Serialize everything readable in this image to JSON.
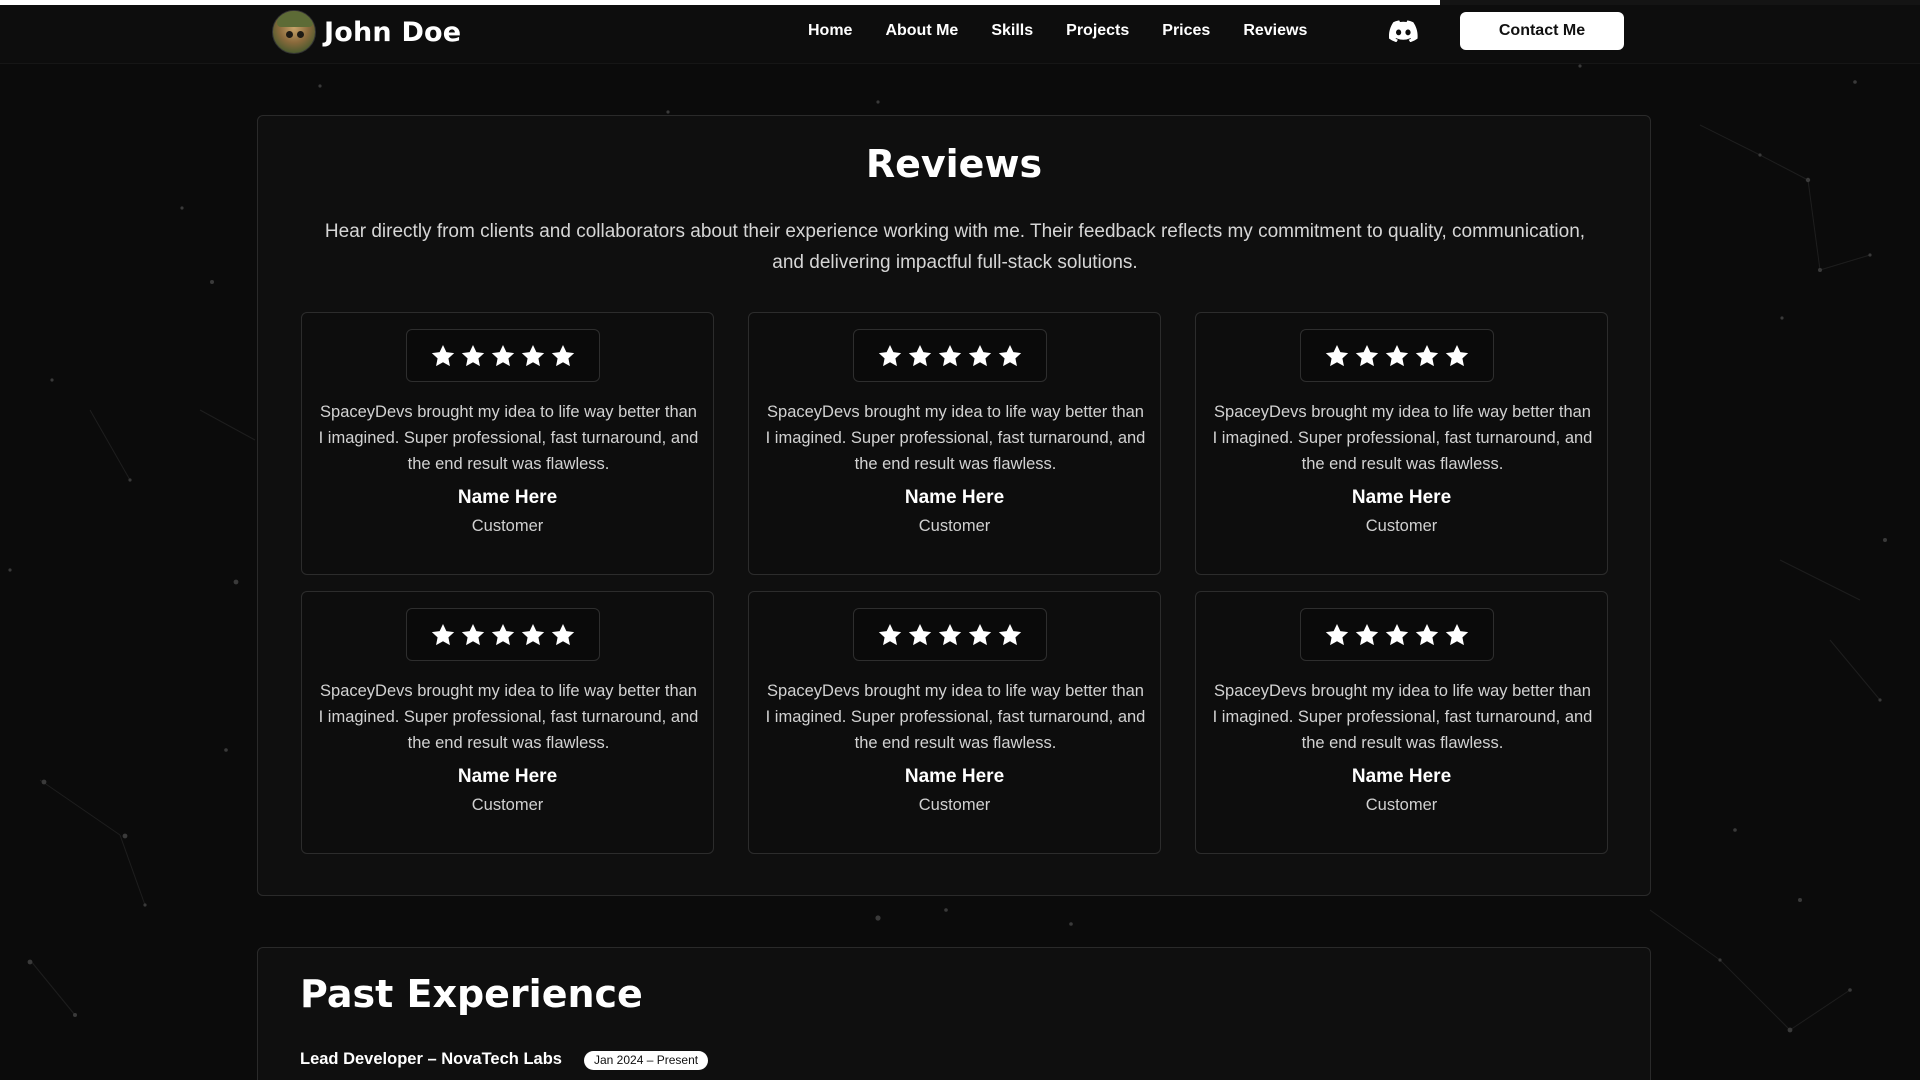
{
  "page": {
    "scroll_progress": 0.75
  },
  "navbar": {
    "brand_name": "John Doe",
    "links": [
      "Home",
      "About Me",
      "Skills",
      "Projects",
      "Prices",
      "Reviews"
    ],
    "discord_icon": "discord-icon",
    "contact_label": "Contact Me"
  },
  "reviews": {
    "title": "Reviews",
    "description": "Hear directly from clients and collaborators about their experience working with me. Their feedback reflects my commitment to quality, communication, and delivering impactful full-stack solutions.",
    "items": [
      {
        "rating": 5,
        "text": "SpaceyDevs brought my idea to life way better than I imagined. Super professional, fast turnaround, and the end result was flawless.",
        "name": "Name Here",
        "role": "Customer"
      },
      {
        "rating": 5,
        "text": "SpaceyDevs brought my idea to life way better than I imagined. Super professional, fast turnaround, and the end result was flawless.",
        "name": "Name Here",
        "role": "Customer"
      },
      {
        "rating": 5,
        "text": "SpaceyDevs brought my idea to life way better than I imagined. Super professional, fast turnaround, and the end result was flawless.",
        "name": "Name Here",
        "role": "Customer"
      },
      {
        "rating": 5,
        "text": "SpaceyDevs brought my idea to life way better than I imagined. Super professional, fast turnaround, and the end result was flawless.",
        "name": "Name Here",
        "role": "Customer"
      },
      {
        "rating": 5,
        "text": "SpaceyDevs brought my idea to life way better than I imagined. Super professional, fast turnaround, and the end result was flawless.",
        "name": "Name Here",
        "role": "Customer"
      },
      {
        "rating": 5,
        "text": "SpaceyDevs brought my idea to life way better than I imagined. Super professional, fast turnaround, and the end result was flawless.",
        "name": "Name Here",
        "role": "Customer"
      }
    ]
  },
  "experience": {
    "title": "Past Experience",
    "role": "Lead Developer – NovaTech Labs",
    "date": "Jan 2024 – Present"
  },
  "colors": {
    "background": "#0b0b0b",
    "card": "#0d0d0d",
    "accent": "#ffffff"
  }
}
